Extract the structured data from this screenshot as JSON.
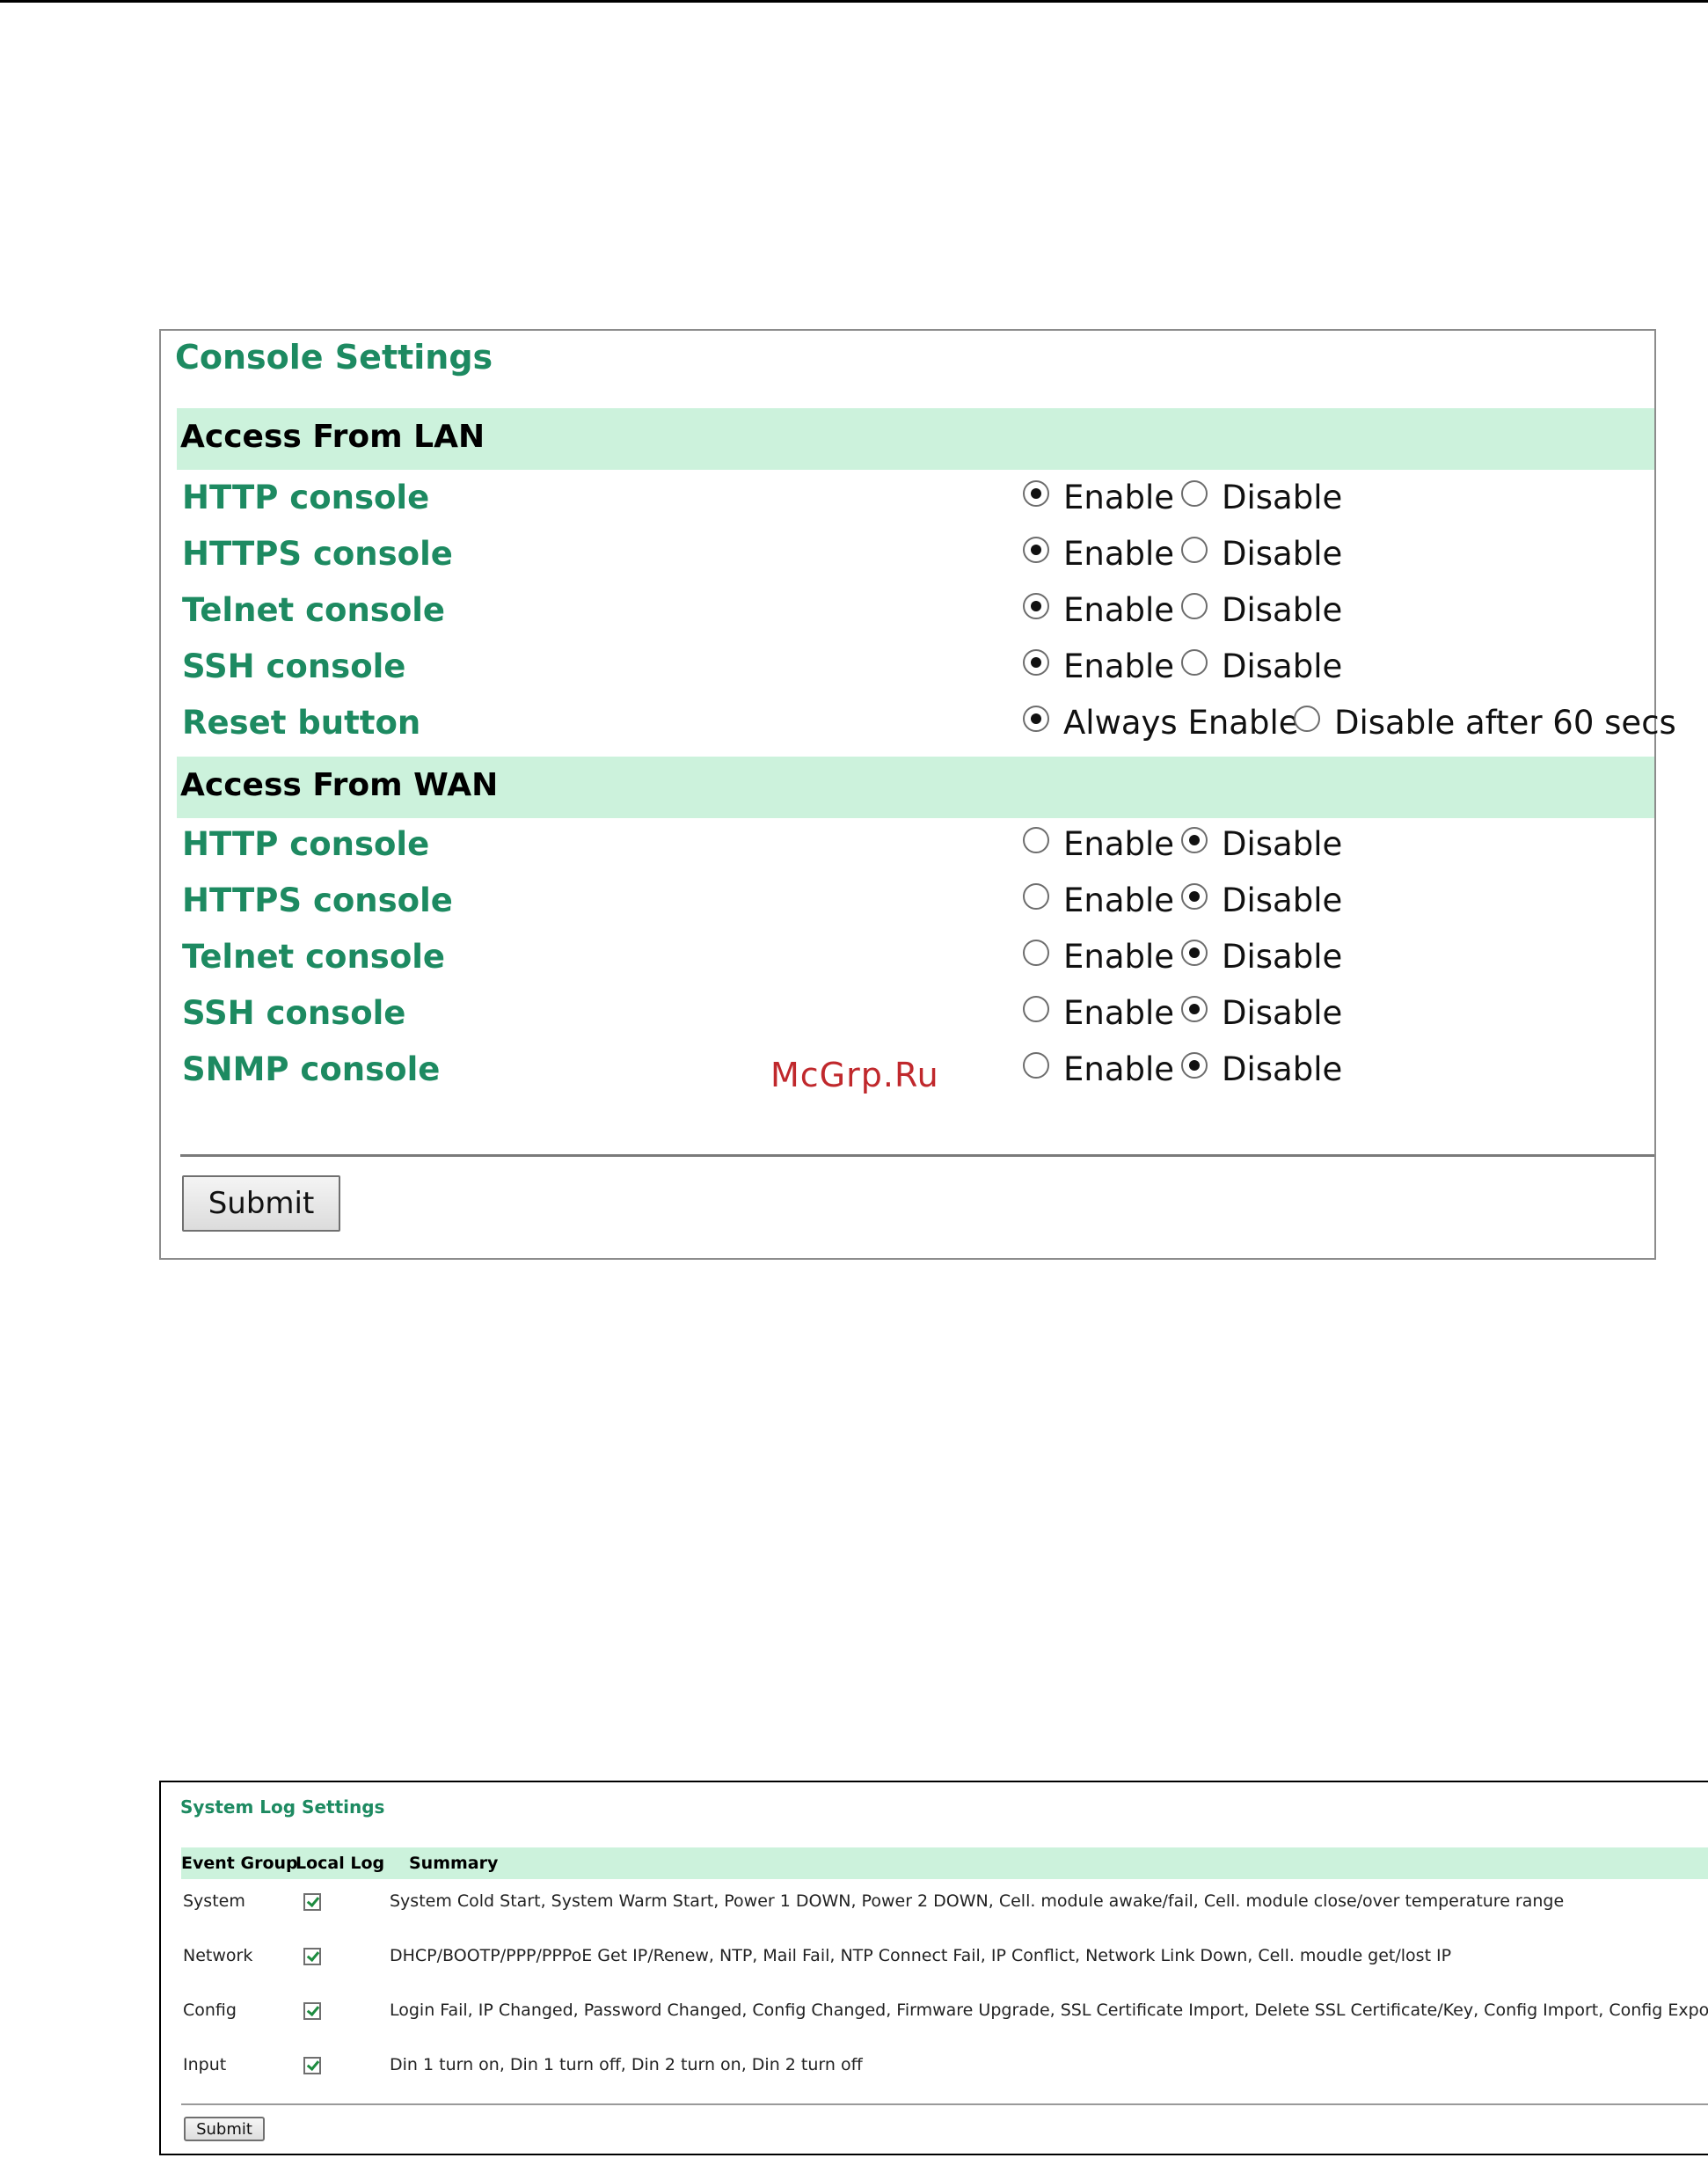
{
  "console": {
    "title": "Console Settings",
    "lan_section": "Access From LAN",
    "wan_section": "Access From WAN",
    "lan_rows": [
      {
        "label": "HTTP console",
        "options": [
          "Enable",
          "Disable"
        ],
        "selected": 0
      },
      {
        "label": "HTTPS console",
        "options": [
          "Enable",
          "Disable"
        ],
        "selected": 0
      },
      {
        "label": "Telnet console",
        "options": [
          "Enable",
          "Disable"
        ],
        "selected": 0
      },
      {
        "label": "SSH console",
        "options": [
          "Enable",
          "Disable"
        ],
        "selected": 0
      },
      {
        "label": "Reset button",
        "options": [
          "Always Enable",
          "Disable after 60 secs"
        ],
        "selected": 0
      }
    ],
    "wan_rows": [
      {
        "label": "HTTP console",
        "options": [
          "Enable",
          "Disable"
        ],
        "selected": 1
      },
      {
        "label": "HTTPS console",
        "options": [
          "Enable",
          "Disable"
        ],
        "selected": 1
      },
      {
        "label": "Telnet console",
        "options": [
          "Enable",
          "Disable"
        ],
        "selected": 1
      },
      {
        "label": "SSH console",
        "options": [
          "Enable",
          "Disable"
        ],
        "selected": 1
      },
      {
        "label": "SNMP console",
        "options": [
          "Enable",
          "Disable"
        ],
        "selected": 1
      }
    ],
    "submit_label": "Submit"
  },
  "watermark": "McGrp.Ru",
  "syslog": {
    "title": "System Log Settings",
    "headers": {
      "event_group": "Event Group",
      "local_log": "Local Log",
      "summary": "Summary"
    },
    "rows": [
      {
        "group": "System",
        "local_log": true,
        "summary": "System Cold Start, System Warm Start, Power 1 DOWN, Power 2 DOWN, Cell. module awake/fail, Cell. module close/over temperature range"
      },
      {
        "group": "Network",
        "local_log": true,
        "summary": "DHCP/BOOTP/PPP/PPPoE Get IP/Renew, NTP, Mail Fail, NTP Connect Fail, IP Conflict, Network Link Down, Cell. moudle get/lost IP"
      },
      {
        "group": "Config",
        "local_log": true,
        "summary": "Login Fail, IP Changed, Password Changed, Config Changed, Firmware Upgrade, SSL Certificate Import, Delete SSL Certificate/Key, Config Import, Config Export"
      },
      {
        "group": "Input",
        "local_log": true,
        "summary": "Din 1 turn on, Din 1 turn off, Din 2 turn on, Din 2 turn off"
      }
    ],
    "submit_label": "Submit"
  }
}
